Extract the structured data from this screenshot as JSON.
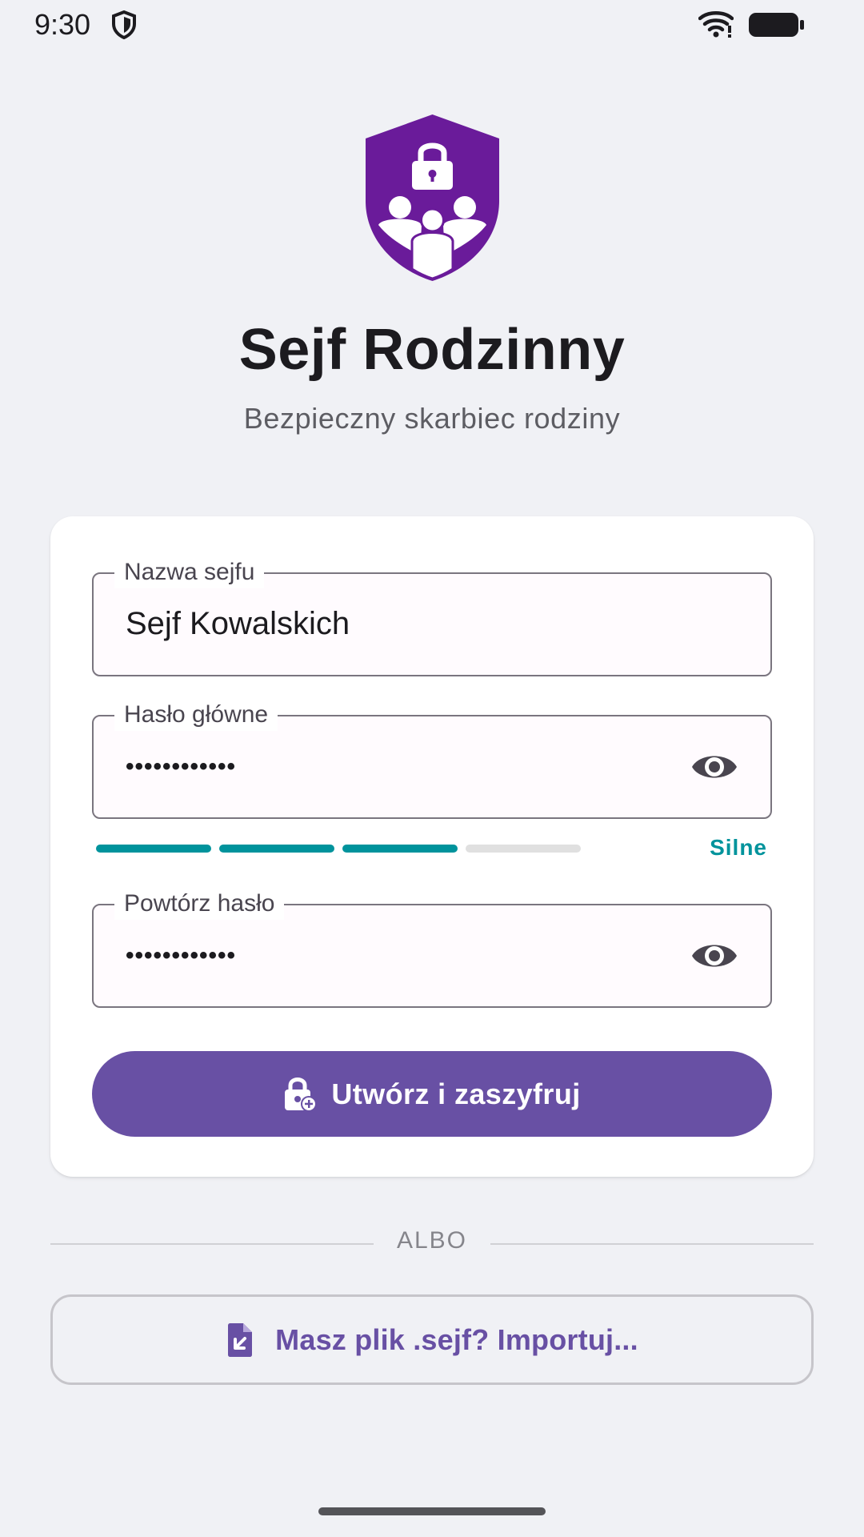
{
  "status_bar": {
    "time": "9:30",
    "icons": [
      "shield-icon",
      "wifi-icon",
      "battery-icon"
    ]
  },
  "header": {
    "logo_icon": "family-shield-lock-icon",
    "title": "Sejf Rodzinny",
    "subtitle": "Bezpieczny skarbiec rodziny"
  },
  "form": {
    "vault_name": {
      "label": "Nazwa sejfu",
      "value": "Sejf Kowalskich"
    },
    "master_password": {
      "label": "Hasło główne",
      "masked_value": "••••••••••••",
      "toggle_icon": "eye-icon"
    },
    "strength": {
      "segments_total": 4,
      "segments_filled": 3,
      "label": "Silne"
    },
    "repeat_password": {
      "label": "Powtórz hasło",
      "masked_value": "••••••••••••",
      "toggle_icon": "eye-icon"
    },
    "submit": {
      "icon": "lock-add-icon",
      "label": "Utwórz i zaszyfruj"
    }
  },
  "divider": {
    "label": "ALBO"
  },
  "import": {
    "icon": "file-import-icon",
    "label": "Masz plik .sejf? Importuj..."
  },
  "colors": {
    "primary": "#6850a4",
    "logo_purple": "#6a1b9a",
    "strength_teal": "#00939c",
    "background": "#f0f1f5"
  }
}
